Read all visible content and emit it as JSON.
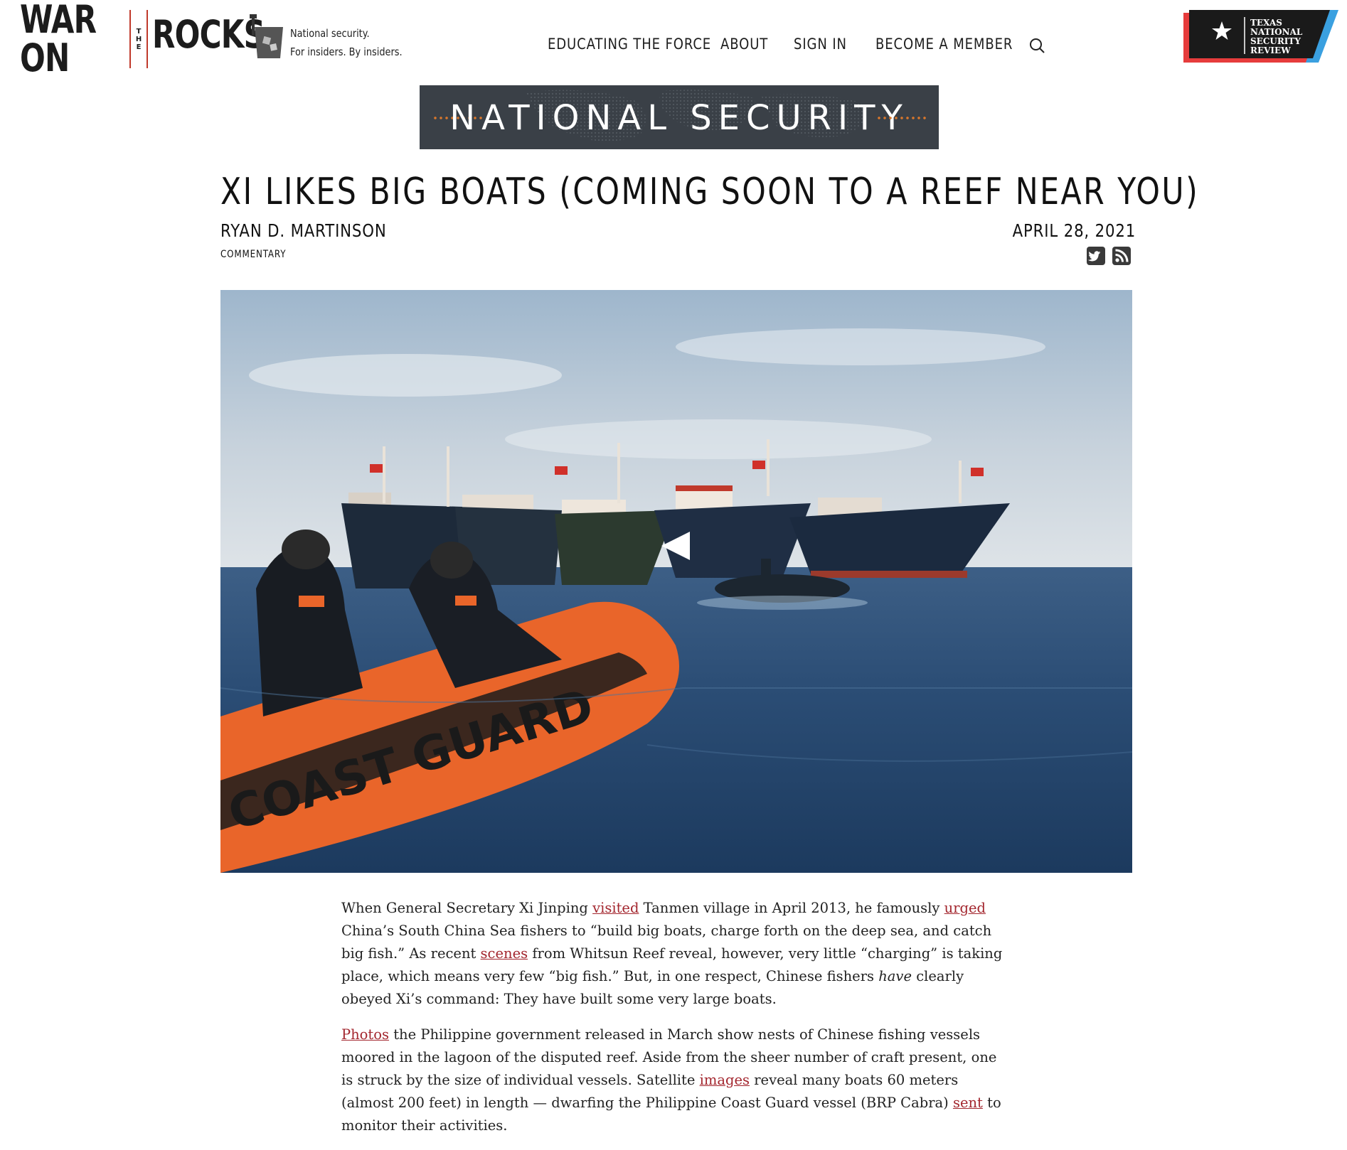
{
  "header": {
    "logo": {
      "word1": "WAR ON",
      "word_the": "THE",
      "word2": "ROCKS"
    },
    "tagline_line1": "National security.",
    "tagline_line2": "For insiders. By insiders.",
    "nav": [
      {
        "label": "EDUCATING THE FORCE"
      },
      {
        "label": "ABOUT"
      },
      {
        "label": "SIGN IN"
      },
      {
        "label": "BECOME A MEMBER"
      }
    ],
    "search_icon": "search-icon",
    "partner_badge": {
      "lines": [
        "TEXAS",
        "NATIONAL",
        "SECURITY",
        "REVIEW"
      ]
    }
  },
  "section": {
    "label": "NATIONAL SECURITY"
  },
  "article": {
    "title": "XI LIKES BIG BOATS (COMING SOON TO A REEF NEAR YOU)",
    "author": "RYAN D. MARTINSON",
    "category": "COMMENTARY",
    "date": "APRIL 28, 2021",
    "share_icons": [
      "twitter-icon",
      "rss-icon"
    ],
    "hero_caption_text": "COAST GUARD",
    "paragraphs": [
      {
        "p1_a": "When General Secretary Xi Jinping ",
        "p1_link1": "visited",
        "p1_b": " Tanmen village in April 2013, he famously ",
        "p1_link2": "urged",
        "p1_c": " China’s South China Sea fishers to “build big boats, charge forth on the deep sea, and catch big fish.” As recent ",
        "p1_link3": "scenes",
        "p1_d": " from Whitsun Reef reveal, however, very little “charging” is taking place, which means very few “big fish.” But, in one respect, Chinese fishers ",
        "p1_em": "have",
        "p1_e": " clearly obeyed Xi’s command: They have built some very large boats."
      },
      {
        "p2_link1": "Photos",
        "p2_a": " the Philippine government released in March show nests of Chinese fishing vessels moored in the lagoon of the disputed reef. Aside from the sheer number of craft present, one is struck by the size of individual vessels. Satellite ",
        "p2_link2": "images",
        "p2_b": " reveal many boats 60 meters (almost 200 feet) in length — dwarfing the Philippine Coast Guard vessel (BRP Cabra) ",
        "p2_link3": "sent",
        "p2_c": " to monitor their activities."
      }
    ]
  },
  "colors": {
    "link": "#a3262e",
    "logo_rule": "#c0392b",
    "banner_bg": "#3a4047",
    "banner_dots": "#d9772b",
    "badge_red": "#e63c3c",
    "badge_blue": "#3aa0e0"
  }
}
